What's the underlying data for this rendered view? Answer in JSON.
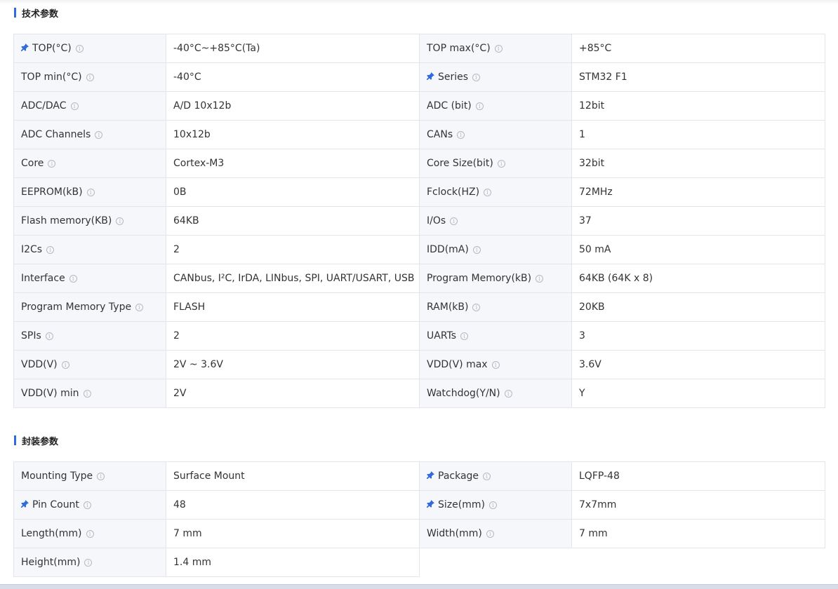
{
  "tech_section": {
    "title": "技术参数",
    "rows": [
      [
        {
          "label": "TOP(°C)",
          "pinned": true,
          "value": "-40°C~+85°C(Ta)"
        },
        {
          "label": "TOP max(°C)",
          "pinned": false,
          "value": "+85°C"
        }
      ],
      [
        {
          "label": "TOP min(°C)",
          "pinned": false,
          "value": "-40°C"
        },
        {
          "label": "Series",
          "pinned": true,
          "value": "STM32 F1"
        }
      ],
      [
        {
          "label": "ADC/DAC",
          "pinned": false,
          "value": "A/D 10x12b"
        },
        {
          "label": "ADC (bit)",
          "pinned": false,
          "value": "12bit"
        }
      ],
      [
        {
          "label": "ADC Channels",
          "pinned": false,
          "value": "10x12b"
        },
        {
          "label": "CANs",
          "pinned": false,
          "value": "1"
        }
      ],
      [
        {
          "label": "Core",
          "pinned": false,
          "value": "Cortex-M3"
        },
        {
          "label": "Core Size(bit)",
          "pinned": false,
          "value": "32bit"
        }
      ],
      [
        {
          "label": "EEPROM(kB)",
          "pinned": false,
          "value": "0B"
        },
        {
          "label": "Fclock(HZ)",
          "pinned": false,
          "value": "72MHz"
        }
      ],
      [
        {
          "label": "Flash memory(KB)",
          "pinned": false,
          "value": "64KB"
        },
        {
          "label": "I/Os",
          "pinned": false,
          "value": "37"
        }
      ],
      [
        {
          "label": "I2Cs",
          "pinned": false,
          "value": "2"
        },
        {
          "label": "IDD(mA)",
          "pinned": false,
          "value": "50 mA"
        }
      ],
      [
        {
          "label": "Interface",
          "pinned": false,
          "value": "CANbus, I²C, IrDA, LINbus, SPI, UART/USART, USB"
        },
        {
          "label": "Program Memory(kB)",
          "pinned": false,
          "value": "64KB (64K x 8)"
        }
      ],
      [
        {
          "label": "Program Memory Type",
          "pinned": false,
          "value": "FLASH"
        },
        {
          "label": "RAM(kB)",
          "pinned": false,
          "value": "20KB"
        }
      ],
      [
        {
          "label": "SPIs",
          "pinned": false,
          "value": "2"
        },
        {
          "label": "UARTs",
          "pinned": false,
          "value": "3"
        }
      ],
      [
        {
          "label": "VDD(V)",
          "pinned": false,
          "value": "2V ~ 3.6V"
        },
        {
          "label": "VDD(V) max",
          "pinned": false,
          "value": "3.6V"
        }
      ],
      [
        {
          "label": "VDD(V) min",
          "pinned": false,
          "value": "2V"
        },
        {
          "label": "Watchdog(Y/N)",
          "pinned": false,
          "value": "Y"
        }
      ]
    ]
  },
  "package_section": {
    "title": "封装参数",
    "rows": [
      [
        {
          "label": "Mounting Type",
          "pinned": false,
          "value": "Surface Mount"
        },
        {
          "label": "Package",
          "pinned": true,
          "value": "LQFP-48"
        }
      ],
      [
        {
          "label": "Pin Count",
          "pinned": true,
          "value": "48"
        },
        {
          "label": "Size(mm)",
          "pinned": true,
          "value": "7x7mm"
        }
      ],
      [
        {
          "label": "Length(mm)",
          "pinned": false,
          "value": "7 mm"
        },
        {
          "label": "Width(mm)",
          "pinned": false,
          "value": "7 mm"
        }
      ],
      [
        {
          "label": "Height(mm)",
          "pinned": false,
          "value": "1.4 mm"
        }
      ]
    ]
  },
  "icons": {
    "pin": "pin-icon",
    "info": "info-icon"
  },
  "colors": {
    "accent": "#2f6bde",
    "label_bg": "#f6f7fa",
    "border": "#e3e5ea"
  }
}
